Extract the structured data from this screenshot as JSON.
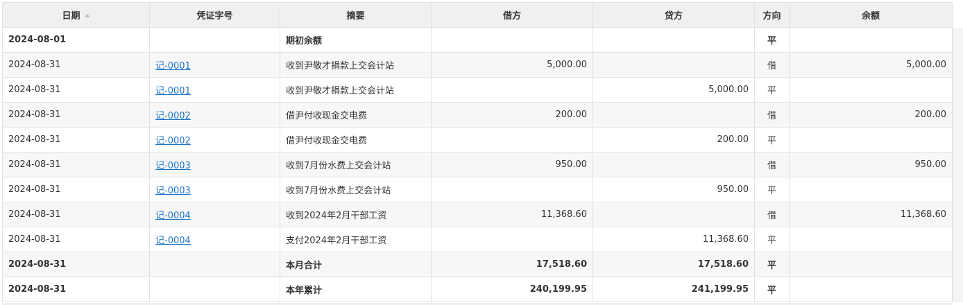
{
  "columns": [
    {
      "key": "date",
      "label": "日期",
      "sortable": true
    },
    {
      "key": "voucher",
      "label": "凭证字号"
    },
    {
      "key": "summary",
      "label": "摘要"
    },
    {
      "key": "debit",
      "label": "借方"
    },
    {
      "key": "credit",
      "label": "贷方"
    },
    {
      "key": "direction",
      "label": "方向"
    },
    {
      "key": "balance",
      "label": "余额"
    }
  ],
  "rows": [
    {
      "date": "2024-08-01",
      "voucher": "",
      "summary": "期初余额",
      "debit": "",
      "credit": "",
      "direction": "平",
      "balance": "",
      "bold": true
    },
    {
      "date": "2024-08-31",
      "voucher": "记-0001",
      "summary": "收到尹敬才捐款上交会计站",
      "debit": "5,000.00",
      "credit": "",
      "direction": "借",
      "balance": "5,000.00"
    },
    {
      "date": "2024-08-31",
      "voucher": "记-0001",
      "summary": "收到尹敬才捐款上交会计站",
      "debit": "",
      "credit": "5,000.00",
      "direction": "平",
      "balance": ""
    },
    {
      "date": "2024-08-31",
      "voucher": "记-0002",
      "summary": "借尹付收现金交电费",
      "debit": "200.00",
      "credit": "",
      "direction": "借",
      "balance": "200.00"
    },
    {
      "date": "2024-08-31",
      "voucher": "记-0002",
      "summary": "借尹付收现金交电费",
      "debit": "",
      "credit": "200.00",
      "direction": "平",
      "balance": ""
    },
    {
      "date": "2024-08-31",
      "voucher": "记-0003",
      "summary": "收到7月份水费上交会计站",
      "debit": "950.00",
      "credit": "",
      "direction": "借",
      "balance": "950.00"
    },
    {
      "date": "2024-08-31",
      "voucher": "记-0003",
      "summary": "收到7月份水费上交会计站",
      "debit": "",
      "credit": "950.00",
      "direction": "平",
      "balance": ""
    },
    {
      "date": "2024-08-31",
      "voucher": "记-0004",
      "summary": "收到2024年2月干部工资",
      "debit": "11,368.60",
      "credit": "",
      "direction": "借",
      "balance": "11,368.60"
    },
    {
      "date": "2024-08-31",
      "voucher": "记-0004",
      "summary": "支付2024年2月干部工资",
      "debit": "",
      "credit": "11,368.60",
      "direction": "平",
      "balance": ""
    },
    {
      "date": "2024-08-31",
      "voucher": "",
      "summary": "本月合计",
      "debit": "17,518.60",
      "credit": "17,518.60",
      "direction": "平",
      "balance": "",
      "bold": true
    },
    {
      "date": "2024-08-31",
      "voucher": "",
      "summary": "本年累计",
      "debit": "240,199.95",
      "credit": "241,199.95",
      "direction": "平",
      "balance": "",
      "bold": true
    }
  ]
}
